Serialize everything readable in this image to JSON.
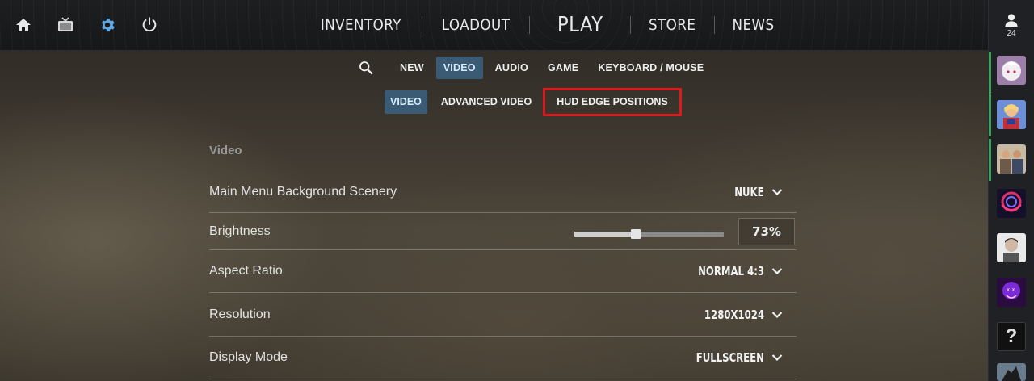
{
  "topnav": {
    "items": [
      "INVENTORY",
      "LOADOUT",
      "PLAY",
      "STORE",
      "NEWS"
    ]
  },
  "left_icons": [
    "home-icon",
    "tv-icon",
    "gear-icon",
    "power-icon"
  ],
  "accent_color": "#5ea8e8",
  "rail": {
    "friend_count": "24",
    "help_label": "?"
  },
  "settings_tabs": [
    "NEW",
    "VIDEO",
    "AUDIO",
    "GAME",
    "KEYBOARD / MOUSE"
  ],
  "settings_tab_active": "VIDEO",
  "sub_tabs": [
    "VIDEO",
    "ADVANCED VIDEO",
    "HUD EDGE POSITIONS"
  ],
  "sub_tab_active": "VIDEO",
  "highlight_color": "#e0171c",
  "section_title": "Video",
  "rows": {
    "scenery": {
      "label": "Main Menu Background Scenery",
      "value": "NUKE"
    },
    "brightness": {
      "label": "Brightness",
      "value": "73%",
      "fraction": 0.41
    },
    "aspect": {
      "label": "Aspect Ratio",
      "value": "NORMAL 4:3"
    },
    "resolution": {
      "label": "Resolution",
      "value": "1280X1024"
    },
    "display": {
      "label": "Display Mode",
      "value": "FULLSCREEN"
    }
  }
}
